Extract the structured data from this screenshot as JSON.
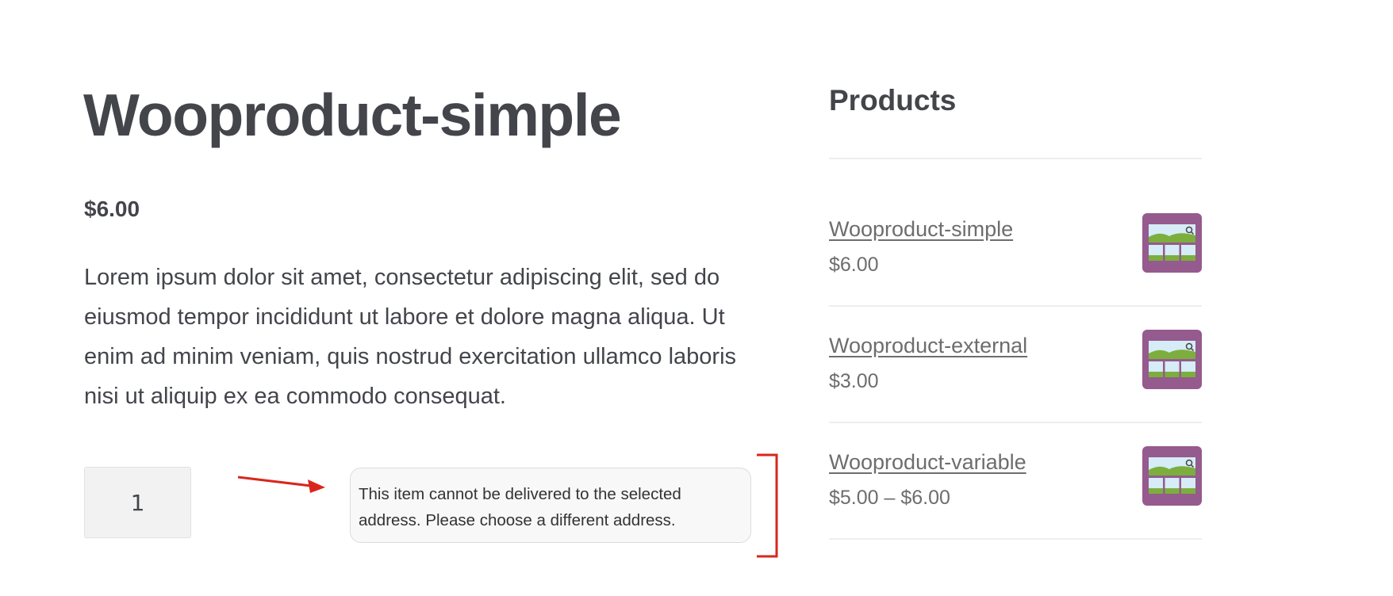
{
  "product": {
    "title": "Wooproduct-simple",
    "price": "$6.00",
    "description": "Lorem ipsum dolor sit amet, consectetur adipiscing elit, sed do eiusmod tempor incididunt ut labore et dolore magna aliqua. Ut enim ad minim veniam, quis nostrud exercitation ullamco laboris nisi ut aliquip ex ea commodo consequat.",
    "quantity": "1",
    "delivery_notice": "This item cannot be delivered to the selected address. Please choose a different address."
  },
  "sidebar": {
    "title": "Products",
    "items": [
      {
        "name": "Wooproduct-simple",
        "price": "$6.00",
        "thumbnail_icon": "image-placeholder-icon"
      },
      {
        "name": "Wooproduct-external",
        "price": "$3.00",
        "thumbnail_icon": "image-placeholder-icon"
      },
      {
        "name": "Wooproduct-variable",
        "price": "$5.00 – $6.00",
        "thumbnail_icon": "image-placeholder-icon"
      }
    ]
  },
  "colors": {
    "text": "#43454b",
    "link": "#6d6d6d",
    "thumbnail_bg": "#955a8e",
    "annotation": "#d9261c"
  }
}
